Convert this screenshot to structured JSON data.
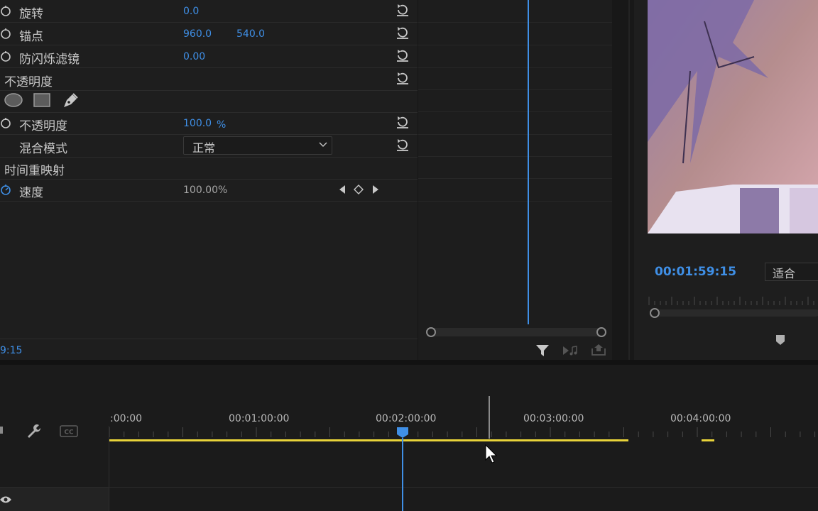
{
  "effect_controls": {
    "rows": [
      {
        "label": "旋转",
        "value": "0.0"
      },
      {
        "label": "锚点",
        "value_x": "960.0",
        "value_y": "540.0"
      },
      {
        "label": "防闪烁滤镜",
        "value": "0.00"
      },
      {
        "label": "不透明度"
      },
      {
        "label": "不透明度",
        "value": "100.0",
        "unit": "%"
      },
      {
        "label": "混合模式",
        "value": "正常"
      },
      {
        "label": "时间重映射"
      },
      {
        "label": "速度",
        "value": "100.00%"
      }
    ],
    "mask_tools": [
      "ellipse-mask-icon",
      "rectangle-mask-icon",
      "pen-mask-icon"
    ],
    "timecode": "9:15"
  },
  "program_monitor": {
    "timecode": "00:01:59:15",
    "fit": "适合"
  },
  "timeline": {
    "ruler_labels": [
      ":00:00",
      "00:01:00:00",
      "00:02:00:00",
      "00:03:00:00",
      "00:04:00:00"
    ]
  },
  "colors": {
    "accent": "#3f8fe6",
    "work_area": "#e8d33a",
    "panel": "#1e1e1e"
  }
}
